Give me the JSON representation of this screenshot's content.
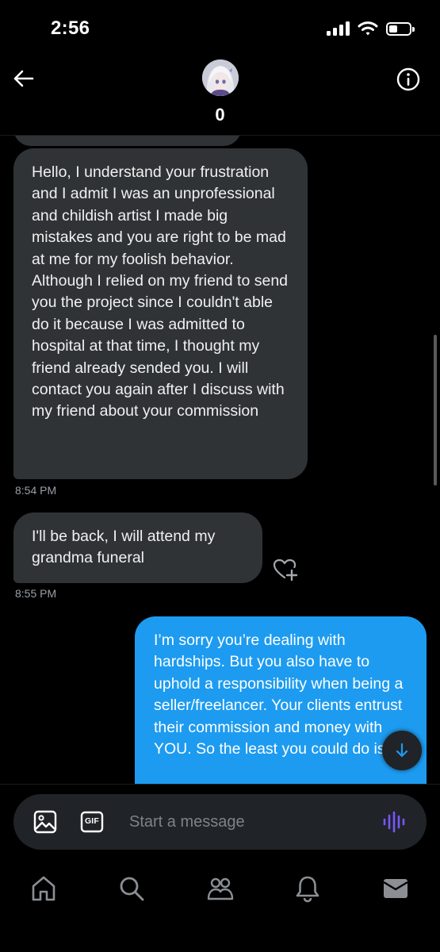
{
  "status_bar": {
    "time": "2:56"
  },
  "header": {
    "contact_name": "0",
    "back_icon": "back-arrow-icon",
    "info_icon": "info-icon"
  },
  "messages": [
    {
      "direction": "received",
      "text": "Hello, I understand your frustration and I admit I was an unprofessional and childish artist I made big mistakes and you are right to be mad at me for my foolish behavior. Although I relied on my friend to send you the project since I couldn't able do it because I was admitted to hospital at that time, I thought my friend already sended you. I will contact you again after I discuss with my friend about your commission",
      "time": "8:54 PM"
    },
    {
      "direction": "received",
      "text": "I'll be back, I will attend my grandma funeral",
      "time": "8:55 PM"
    },
    {
      "direction": "sent",
      "text": "I’m sorry you’re dealing with hardships. But you also have to uphold a responsibility when being a seller/freelancer. Your clients entrust their commission and money with YOU. So the least you could do is be"
    }
  ],
  "composer": {
    "placeholder": "Start a message",
    "gif_label": "GIF"
  },
  "bottom_nav": {
    "items": [
      "home-icon",
      "search-icon",
      "communities-icon",
      "notifications-icon",
      "messages-icon"
    ]
  },
  "colors": {
    "accent": "#1d9bf0",
    "received_bubble": "#2f3336",
    "voice_icon": "#7856ff",
    "background": "#000000"
  }
}
